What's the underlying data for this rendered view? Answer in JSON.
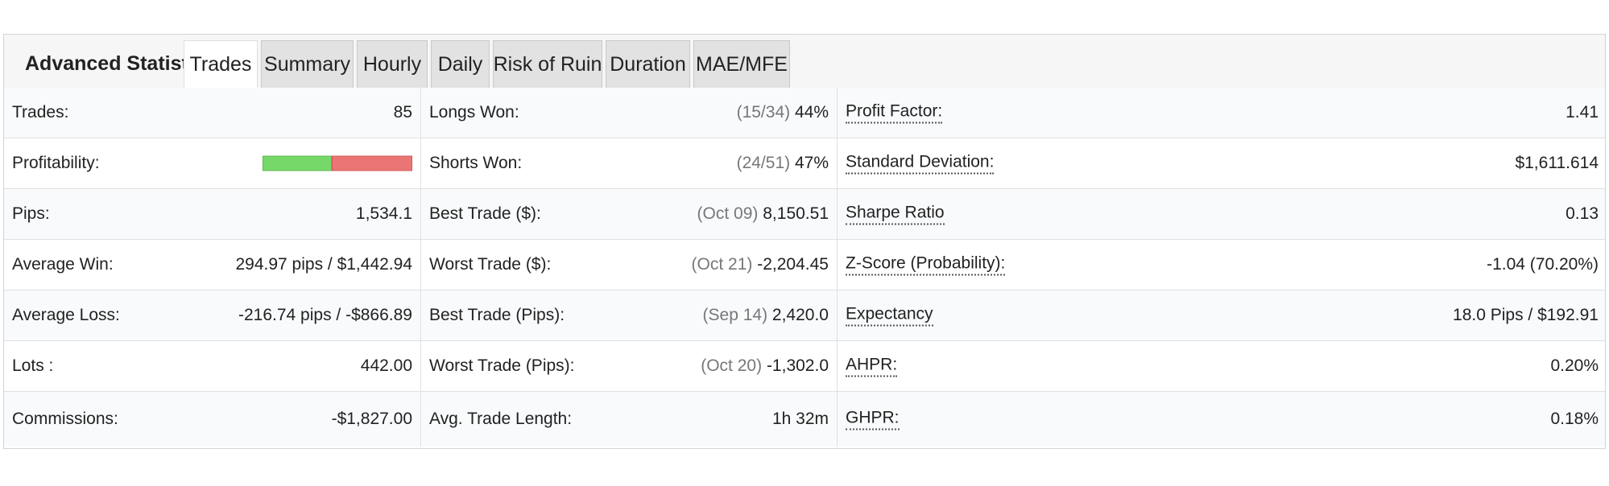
{
  "header": {
    "title": "Advanced Statistics"
  },
  "tabs": [
    {
      "label": "Trades",
      "active": true
    },
    {
      "label": "Summary",
      "active": false
    },
    {
      "label": "Hourly",
      "active": false
    },
    {
      "label": "Daily",
      "active": false
    },
    {
      "label": "Risk of Ruin",
      "active": false
    },
    {
      "label": "Duration",
      "active": false
    },
    {
      "label": "MAE/MFE",
      "active": false
    }
  ],
  "colors": {
    "win": "#77d86a",
    "loss": "#eb7575",
    "tab_inactive": "#e2e2e2",
    "tab_active": "#ffffff"
  },
  "stats": {
    "col1": [
      {
        "label": "Trades:",
        "value": "85"
      },
      {
        "label": "Profitability:",
        "bar": {
          "win_fraction": 0.46
        }
      },
      {
        "label": "Pips:",
        "value": "1,534.1"
      },
      {
        "label": "Average Win:",
        "value": "294.97 pips / $1,442.94"
      },
      {
        "label": "Average Loss:",
        "value": "-216.74 pips / -$866.89"
      },
      {
        "label": "Lots :",
        "value": "442.00"
      },
      {
        "label": "Commissions:",
        "value": "-$1,827.00"
      }
    ],
    "col2": [
      {
        "label": "Longs Won:",
        "note": "(15/34)",
        "value": "44%"
      },
      {
        "label": "Shorts Won:",
        "note": "(24/51)",
        "value": "47%"
      },
      {
        "label": "Best Trade ($):",
        "note": "(Oct 09)",
        "value": "8,150.51"
      },
      {
        "label": "Worst Trade ($):",
        "note": "(Oct 21)",
        "value": "-2,204.45"
      },
      {
        "label": "Best Trade (Pips):",
        "note": "(Sep 14)",
        "value": "2,420.0"
      },
      {
        "label": "Worst Trade (Pips):",
        "note": "(Oct 20)",
        "value": "-1,302.0"
      },
      {
        "label": "Avg. Trade Length:",
        "note": "",
        "value": "1h 32m"
      }
    ],
    "col3": [
      {
        "label": "Profit Factor:",
        "value": "1.41"
      },
      {
        "label": "Standard Deviation:",
        "value": "$1,611.614"
      },
      {
        "label": "Sharpe Ratio",
        "value": "0.13"
      },
      {
        "label": "Z-Score (Probability):",
        "value": "-1.04 (70.20%)"
      },
      {
        "label": "Expectancy",
        "value": "18.0 Pips / $192.91"
      },
      {
        "label": "AHPR:",
        "value": "0.20%"
      },
      {
        "label": "GHPR:",
        "value": "0.18%"
      }
    ]
  }
}
